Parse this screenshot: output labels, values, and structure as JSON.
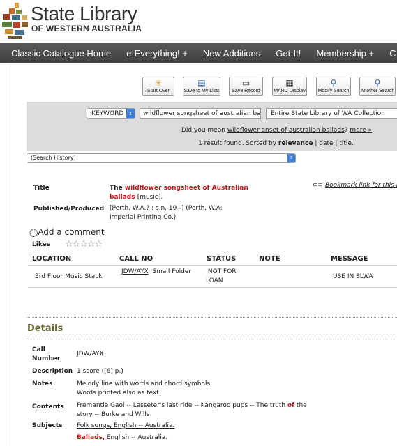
{
  "brand": {
    "title": "State Library",
    "subtitle": "OF WESTERN AUSTRALIA"
  },
  "nav": [
    "Classic Catalogue Home",
    "e-Everything! +",
    "New Additions",
    "Get-It!",
    "Membership +",
    "C"
  ],
  "toolbar": {
    "start_over": "Start Over",
    "save_to_lists": "Save to My Lists",
    "save_record": "Save Record",
    "marc_display": "MARC Display",
    "modify_search": "Modify Search",
    "another_search": "Another Search"
  },
  "search": {
    "type": "KEYWORD",
    "query": "wildflower songsheet of australian ballad",
    "collection": "Entire State Library of WA Collection",
    "did_you_mean_prefix": "Did you mean",
    "did_you_mean_link": "wildflower onset of australian ballads",
    "did_you_mean_sep": "?",
    "more_link": "more »",
    "results_prefix": "1 result found. Sorted by",
    "sort_relevance": "relevance",
    "sort_sep1": "|",
    "sort_date": "date",
    "sort_sep2": "|",
    "sort_title": "title",
    "sort_end": ".",
    "history": "(Search History)"
  },
  "record": {
    "title_label": "Title",
    "title_pre": "The",
    "title_red1": "wildflower songsheet of Australian",
    "title_red2": "ballads",
    "title_post": "[music].",
    "published_label": "Published/Produced",
    "published_line1": "[Perth, W.A.? : s.n, 19--] (Perth, W.A:",
    "published_line2": "Imperial Printing Co.)",
    "bookmark": "Bookmark link for this re",
    "add_comment": "Add a comment",
    "likes_label": "Likes",
    "stars": "☆☆☆☆☆"
  },
  "holdings": {
    "headers": [
      "LOCATION",
      "CALL NO",
      "STATUS",
      "NOTE",
      "MESSAGE"
    ],
    "rows": [
      {
        "location": "3rd Floor Music Stack",
        "call_no": "JDW/AYX",
        "call_extra": "Small Folder",
        "status_line1": "NOT FOR",
        "status_line2": "LOAN",
        "note": "",
        "message": "USE IN SLWA"
      }
    ]
  },
  "details": {
    "heading": "Details",
    "call_number_label1": "Call",
    "call_number_label2": "Number",
    "call_number": "JDW/AYX",
    "description_label": "Description",
    "description": "1 score ([6] p.)",
    "notes_label": "Notes",
    "notes1": "Melody line with words and chord symbols.",
    "notes2": "Words printed also as text.",
    "contents_label": "Contents",
    "contents1_pre": "Fremantle Gaol -- Lasseter's last ride -- Kangaroo pups -- The truth",
    "contents1_red": "of",
    "contents1_post": "the",
    "contents2": "story -- Burke and Wills",
    "subjects_label": "Subjects",
    "subject1": "Folk songs, English -- Australia.",
    "subject2_red": "Ballads",
    "subject2_post": ", English -- Australia."
  },
  "colors": {
    "accent_red": "#c8161d",
    "nav_bg": "#4a4a4a",
    "details_heading": "#6b6b3a",
    "select_blue": "#3f7fd9"
  }
}
